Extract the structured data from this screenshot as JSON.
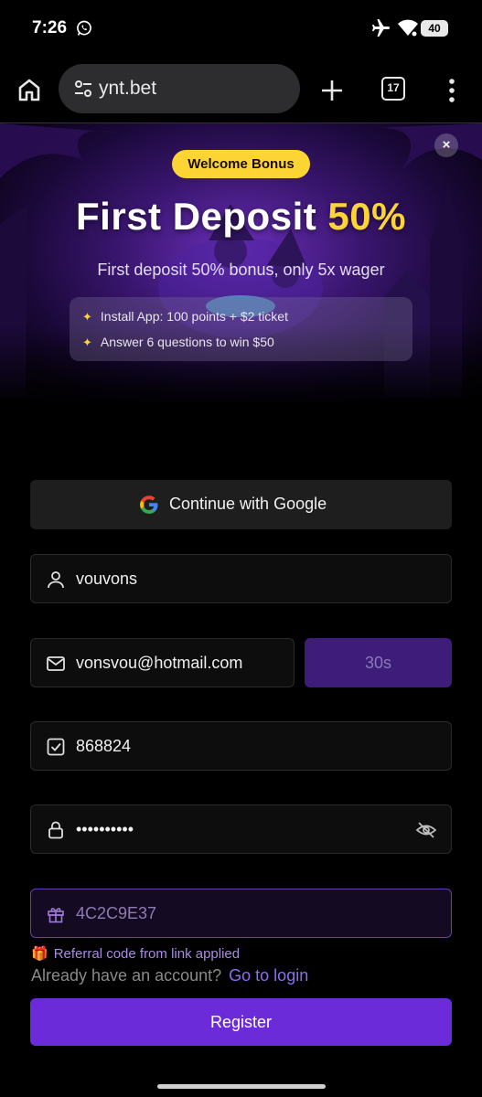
{
  "status_bar": {
    "time": "7:26",
    "battery": "40",
    "icons": [
      "whatsapp-icon",
      "airplane-icon",
      "wifi-icon",
      "battery-icon"
    ]
  },
  "browser": {
    "url": "ynt.bet",
    "tab_count": "17",
    "icons": [
      "home-icon",
      "tune-icon",
      "plus-icon",
      "tabs-icon",
      "more-vert-icon"
    ]
  },
  "banner": {
    "badge": "Welcome Bonus",
    "headline_main": "First Deposit ",
    "headline_highlight": "50%",
    "subtitle": "First deposit 50% bonus, only 5x wager",
    "perks": [
      "Install App: 100 points + $2 ticket",
      "Answer 6 questions to win $50"
    ],
    "close_label": "×",
    "colors": {
      "accent": "#fcd535",
      "bg": "#3a1670"
    }
  },
  "form": {
    "google_label": "Continue with Google",
    "username": "vouvons",
    "email": "vonsvou@hotmail.com",
    "timer": "30s",
    "code": "868824",
    "password": "••••••••••",
    "referral": "4C2C9E37",
    "referral_note": "Referral code from link applied",
    "have_account": "Already have an account?",
    "login_link": "Go to login",
    "register_label": "Register",
    "colors": {
      "primary": "#6c2bd9",
      "link": "#8f6cf5",
      "timer_bg": "#3d1c7a"
    }
  }
}
